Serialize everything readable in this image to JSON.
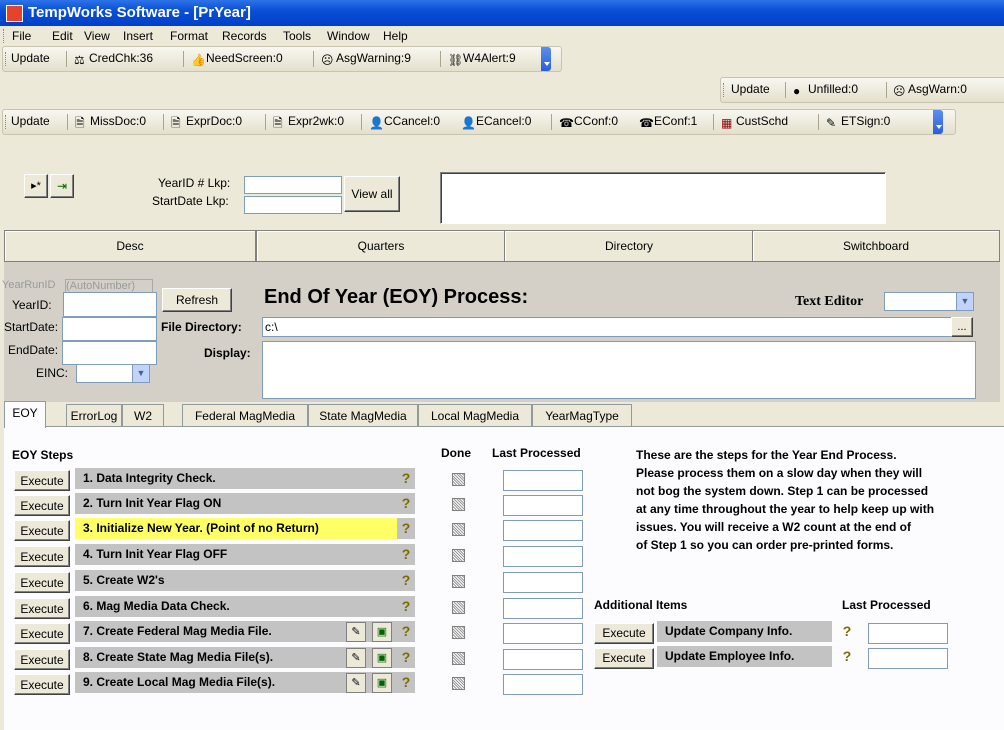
{
  "window": {
    "title": "TempWorks Software - [PrYear]"
  },
  "menu": [
    "File",
    "Edit",
    "View",
    "Insert",
    "Format",
    "Records",
    "Tools",
    "Window",
    "Help"
  ],
  "toolbar1": [
    "Update",
    "CredChk:36",
    "NeedScreen:0",
    "AsgWarning:9",
    "W4Alert:9"
  ],
  "toolbar2": [
    "Update",
    "Unfilled:0",
    "AsgWarn:0"
  ],
  "toolbar3": [
    "Update",
    "MissDoc:0",
    "ExprDoc:0",
    "Expr2wk:0",
    "CCancel:0",
    "ECancel:0",
    "CConf:0",
    "EConf:1",
    "CustSchd",
    "ETSign:0"
  ],
  "lookup": {
    "yearid_label": "YearID # Lkp:",
    "startdate_label": "StartDate Lkp:",
    "viewall": "View all",
    "new_glyph": "▸*",
    "exit_glyph": "⇥"
  },
  "nav_tabs": [
    "Desc",
    "Quarters",
    "Directory",
    "Switchboard"
  ],
  "form": {
    "yearrunid_label": "YearRunID",
    "yearrunid_value": "(AutoNumber)",
    "yearid_label": "YearID:",
    "startdate_label": "StartDate:",
    "enddate_label": "EndDate:",
    "einc_label": "EINC:",
    "refresh": "Refresh",
    "heading": "End Of Year (EOY) Process:",
    "text_editor_label": "Text Editor",
    "file_directory_label": "File Directory:",
    "file_directory_value": "c:\\",
    "browse": "...",
    "display_label": "Display:"
  },
  "tabs": [
    "EOY",
    "ErrorLog",
    "W2",
    "Federal MagMedia",
    "State MagMedia",
    "Local MagMedia",
    "YearMagType"
  ],
  "eoy": {
    "steps_header": "EOY Steps",
    "done_header": "Done",
    "last_processed_header": "Last Processed",
    "execute": "Execute",
    "steps": [
      "1. Data Integrity Check.",
      "2. Turn Init Year Flag ON",
      "3. Initialize New Year. (Point of no Return)",
      "4. Turn Init Year Flag OFF",
      "5. Create W2's",
      "6. Mag Media Data Check.",
      "7. Create Federal Mag Media File.",
      "8. Create State Mag Media File(s).",
      "9. Create Local Mag Media File(s)."
    ],
    "instructions": [
      "These are the steps for the Year End Process.",
      "Please process them on a slow day when they will",
      "not bog the system down.  Step 1 can be processed",
      "at any time throughout the year to help keep up with",
      "issues.  You will receive a W2 count at the end of",
      "of Step 1 so you can order pre-printed forms."
    ],
    "additional_header": "Additional Items",
    "additional_last_processed": "Last Processed",
    "additional": [
      "Update Company Info.",
      "Update Employee Info."
    ],
    "help_glyph": "?"
  }
}
